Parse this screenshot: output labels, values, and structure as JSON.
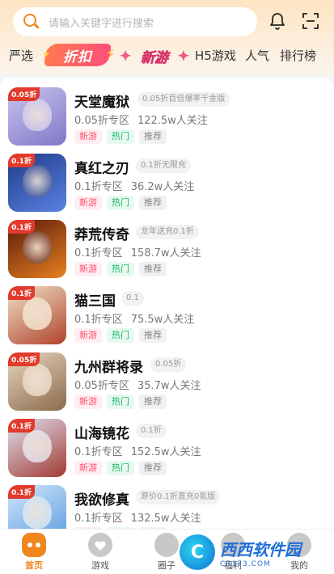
{
  "search": {
    "placeholder": "请输入关键字进行搜索"
  },
  "tabs": {
    "strict": "严选",
    "discount": "折扣",
    "newgame": "新游",
    "h5": "H5游戏",
    "popular": "人气",
    "ranking": "排行榜"
  },
  "games": [
    {
      "name": "天堂魔狱",
      "promo": "0.05折百倍爆率千金版",
      "zone": "0.05折专区",
      "followers": "122.5w人关注",
      "badge": "0.05折",
      "colors": [
        "#c9c3f0",
        "#7f79c6"
      ]
    },
    {
      "name": "真红之刃",
      "promo": "0.1折无限充",
      "zone": "0.1折专区",
      "followers": "36.2w人关注",
      "badge": "0.1折",
      "colors": [
        "#1f3b8a",
        "#5a82e0"
      ]
    },
    {
      "name": "莽荒传奇",
      "promo": "龙年送充0.1折",
      "zone": "0.1折专区",
      "followers": "158.7w人关注",
      "badge": "0.1折",
      "colors": [
        "#5a1a0c",
        "#e8801e"
      ]
    },
    {
      "name": "猫三国",
      "promo": "0.1",
      "zone": "0.1折专区",
      "followers": "75.5w人关注",
      "badge": "0.1折",
      "colors": [
        "#f0e2c8",
        "#b0422c"
      ]
    },
    {
      "name": "九州群将录",
      "promo": "0.05折",
      "zone": "0.05折专区",
      "followers": "35.7w人关注",
      "badge": "0.05折",
      "colors": [
        "#e8d6c0",
        "#8a6a4c"
      ]
    },
    {
      "name": "山海镜花",
      "promo": "0.1折",
      "zone": "0.1折专区",
      "followers": "152.5w人关注",
      "badge": "0.1折",
      "colors": [
        "#dfe2f2",
        "#a23a32"
      ]
    },
    {
      "name": "我欲修真",
      "promo": "原价0.1折直充0氪版",
      "zone": "0.1折专区",
      "followers": "132.5w人关注",
      "badge": "0.1折",
      "colors": [
        "#cfe6fb",
        "#5a9ae0"
      ]
    }
  ],
  "tags": {
    "new": "新游",
    "hot": "热门",
    "rec": "推荐"
  },
  "nav": {
    "home": "首页",
    "games": "游戏",
    "circle": "圈子",
    "welfare": "福利",
    "mine": "我的"
  },
  "watermark": {
    "title": "西西软件园",
    "subtitle": "CR173.COM",
    "logo_letter": "C"
  },
  "colors": {
    "accent": "#f0861e",
    "new": "#ff4d6d",
    "hot": "#1ab96a"
  }
}
